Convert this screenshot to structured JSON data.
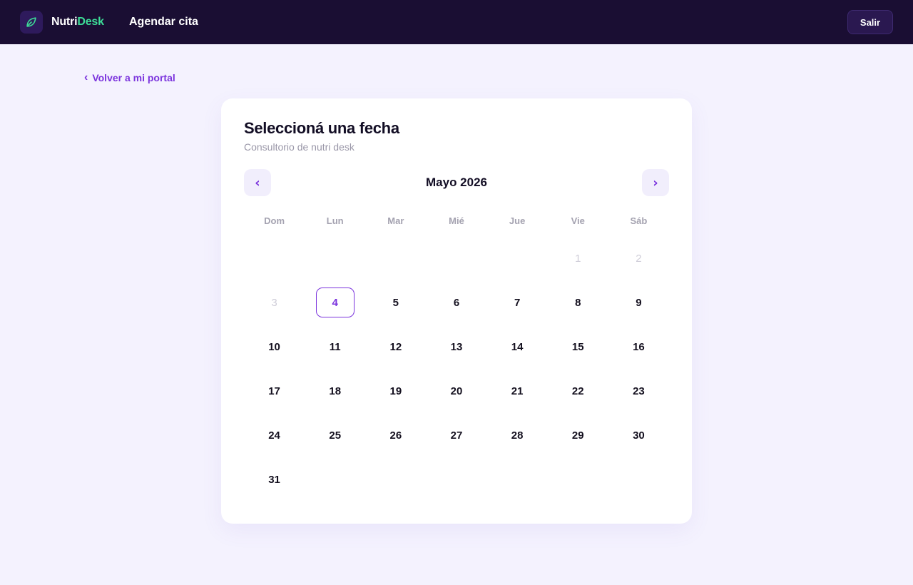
{
  "header": {
    "logo_icon": "leaf-icon",
    "brand_part1": "Nutri",
    "brand_part2": "Desk",
    "page_title": "Agendar cita",
    "logout_label": "Salir"
  },
  "back_link": {
    "label": "Volver a mi portal",
    "icon": "chevron-left-icon"
  },
  "card": {
    "title": "Seleccioná una fecha",
    "subtitle": "Consultorio de nutri desk"
  },
  "calendar": {
    "month_label": "Mayo 2026",
    "prev_label": "‹",
    "next_label": "›",
    "weekdays": [
      "Dom",
      "Lun",
      "Mar",
      "Mié",
      "Jue",
      "Vie",
      "Sáb"
    ],
    "leading_blanks": 5,
    "days": [
      {
        "label": "1",
        "state": "disabled"
      },
      {
        "label": "2",
        "state": "disabled"
      },
      {
        "label": "3",
        "state": "disabled"
      },
      {
        "label": "4",
        "state": "selected"
      },
      {
        "label": "5",
        "state": "available"
      },
      {
        "label": "6",
        "state": "available"
      },
      {
        "label": "7",
        "state": "available"
      },
      {
        "label": "8",
        "state": "available"
      },
      {
        "label": "9",
        "state": "available"
      },
      {
        "label": "10",
        "state": "available"
      },
      {
        "label": "11",
        "state": "available"
      },
      {
        "label": "12",
        "state": "available"
      },
      {
        "label": "13",
        "state": "available"
      },
      {
        "label": "14",
        "state": "available"
      },
      {
        "label": "15",
        "state": "available"
      },
      {
        "label": "16",
        "state": "available"
      },
      {
        "label": "17",
        "state": "available"
      },
      {
        "label": "18",
        "state": "available"
      },
      {
        "label": "19",
        "state": "available"
      },
      {
        "label": "20",
        "state": "available"
      },
      {
        "label": "21",
        "state": "available"
      },
      {
        "label": "22",
        "state": "available"
      },
      {
        "label": "23",
        "state": "available"
      },
      {
        "label": "24",
        "state": "available"
      },
      {
        "label": "25",
        "state": "available"
      },
      {
        "label": "26",
        "state": "available"
      },
      {
        "label": "27",
        "state": "available"
      },
      {
        "label": "28",
        "state": "available"
      },
      {
        "label": "29",
        "state": "available"
      },
      {
        "label": "30",
        "state": "available"
      },
      {
        "label": "31",
        "state": "available"
      }
    ]
  },
  "colors": {
    "header_bg": "#1a0e33",
    "accent_purple": "#7b34dd",
    "accent_green": "#3ddc97",
    "page_bg": "#f4f2fe"
  }
}
